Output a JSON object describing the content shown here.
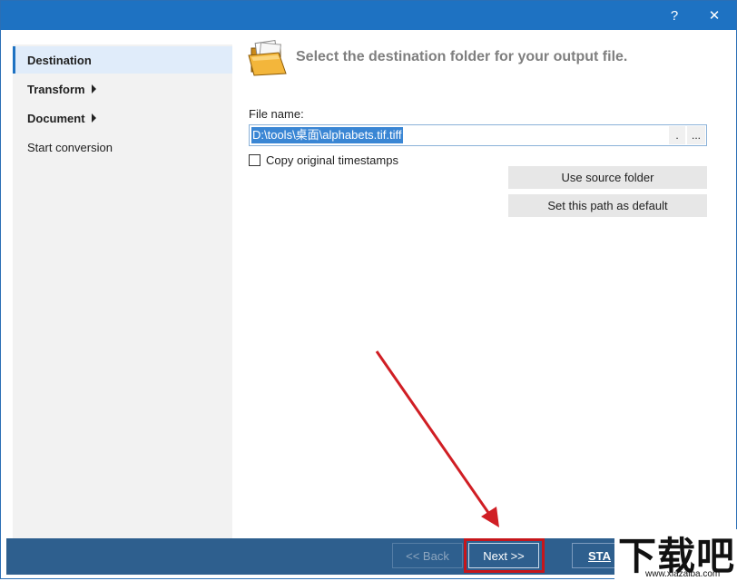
{
  "window": {
    "help_label": "?",
    "close_label": "✕"
  },
  "sidebar": {
    "items": [
      {
        "label": "Destination",
        "state": "active"
      },
      {
        "label": "Transform",
        "has_submenu": true
      },
      {
        "label": "Document",
        "has_submenu": true
      },
      {
        "label": "Start conversion"
      }
    ]
  },
  "main": {
    "heading": "Select the destination folder for your output file.",
    "folder_icon": "folder-open-icon",
    "file_name_label": "File name:",
    "file_name_value": "D:\\tools\\桌面\\alphabets.tif.tiff",
    "dot_button_label": ".",
    "browse_button_label": "...",
    "copy_timestamps_label": "Copy original timestamps",
    "copy_timestamps_checked": false,
    "use_source_folder_label": "Use source folder",
    "set_default_path_label": "Set this path as default"
  },
  "footer": {
    "back_label": "<< Back",
    "back_enabled": false,
    "next_label": "Next >>",
    "start_label": "STA"
  },
  "watermark": {
    "text": "下载吧",
    "url": "www.xiazaiba.com"
  },
  "colors": {
    "title_bar": "#1e72c2",
    "footer": "#2e5f8e",
    "highlight": "#c6161b",
    "selection": "#3a86d4"
  }
}
